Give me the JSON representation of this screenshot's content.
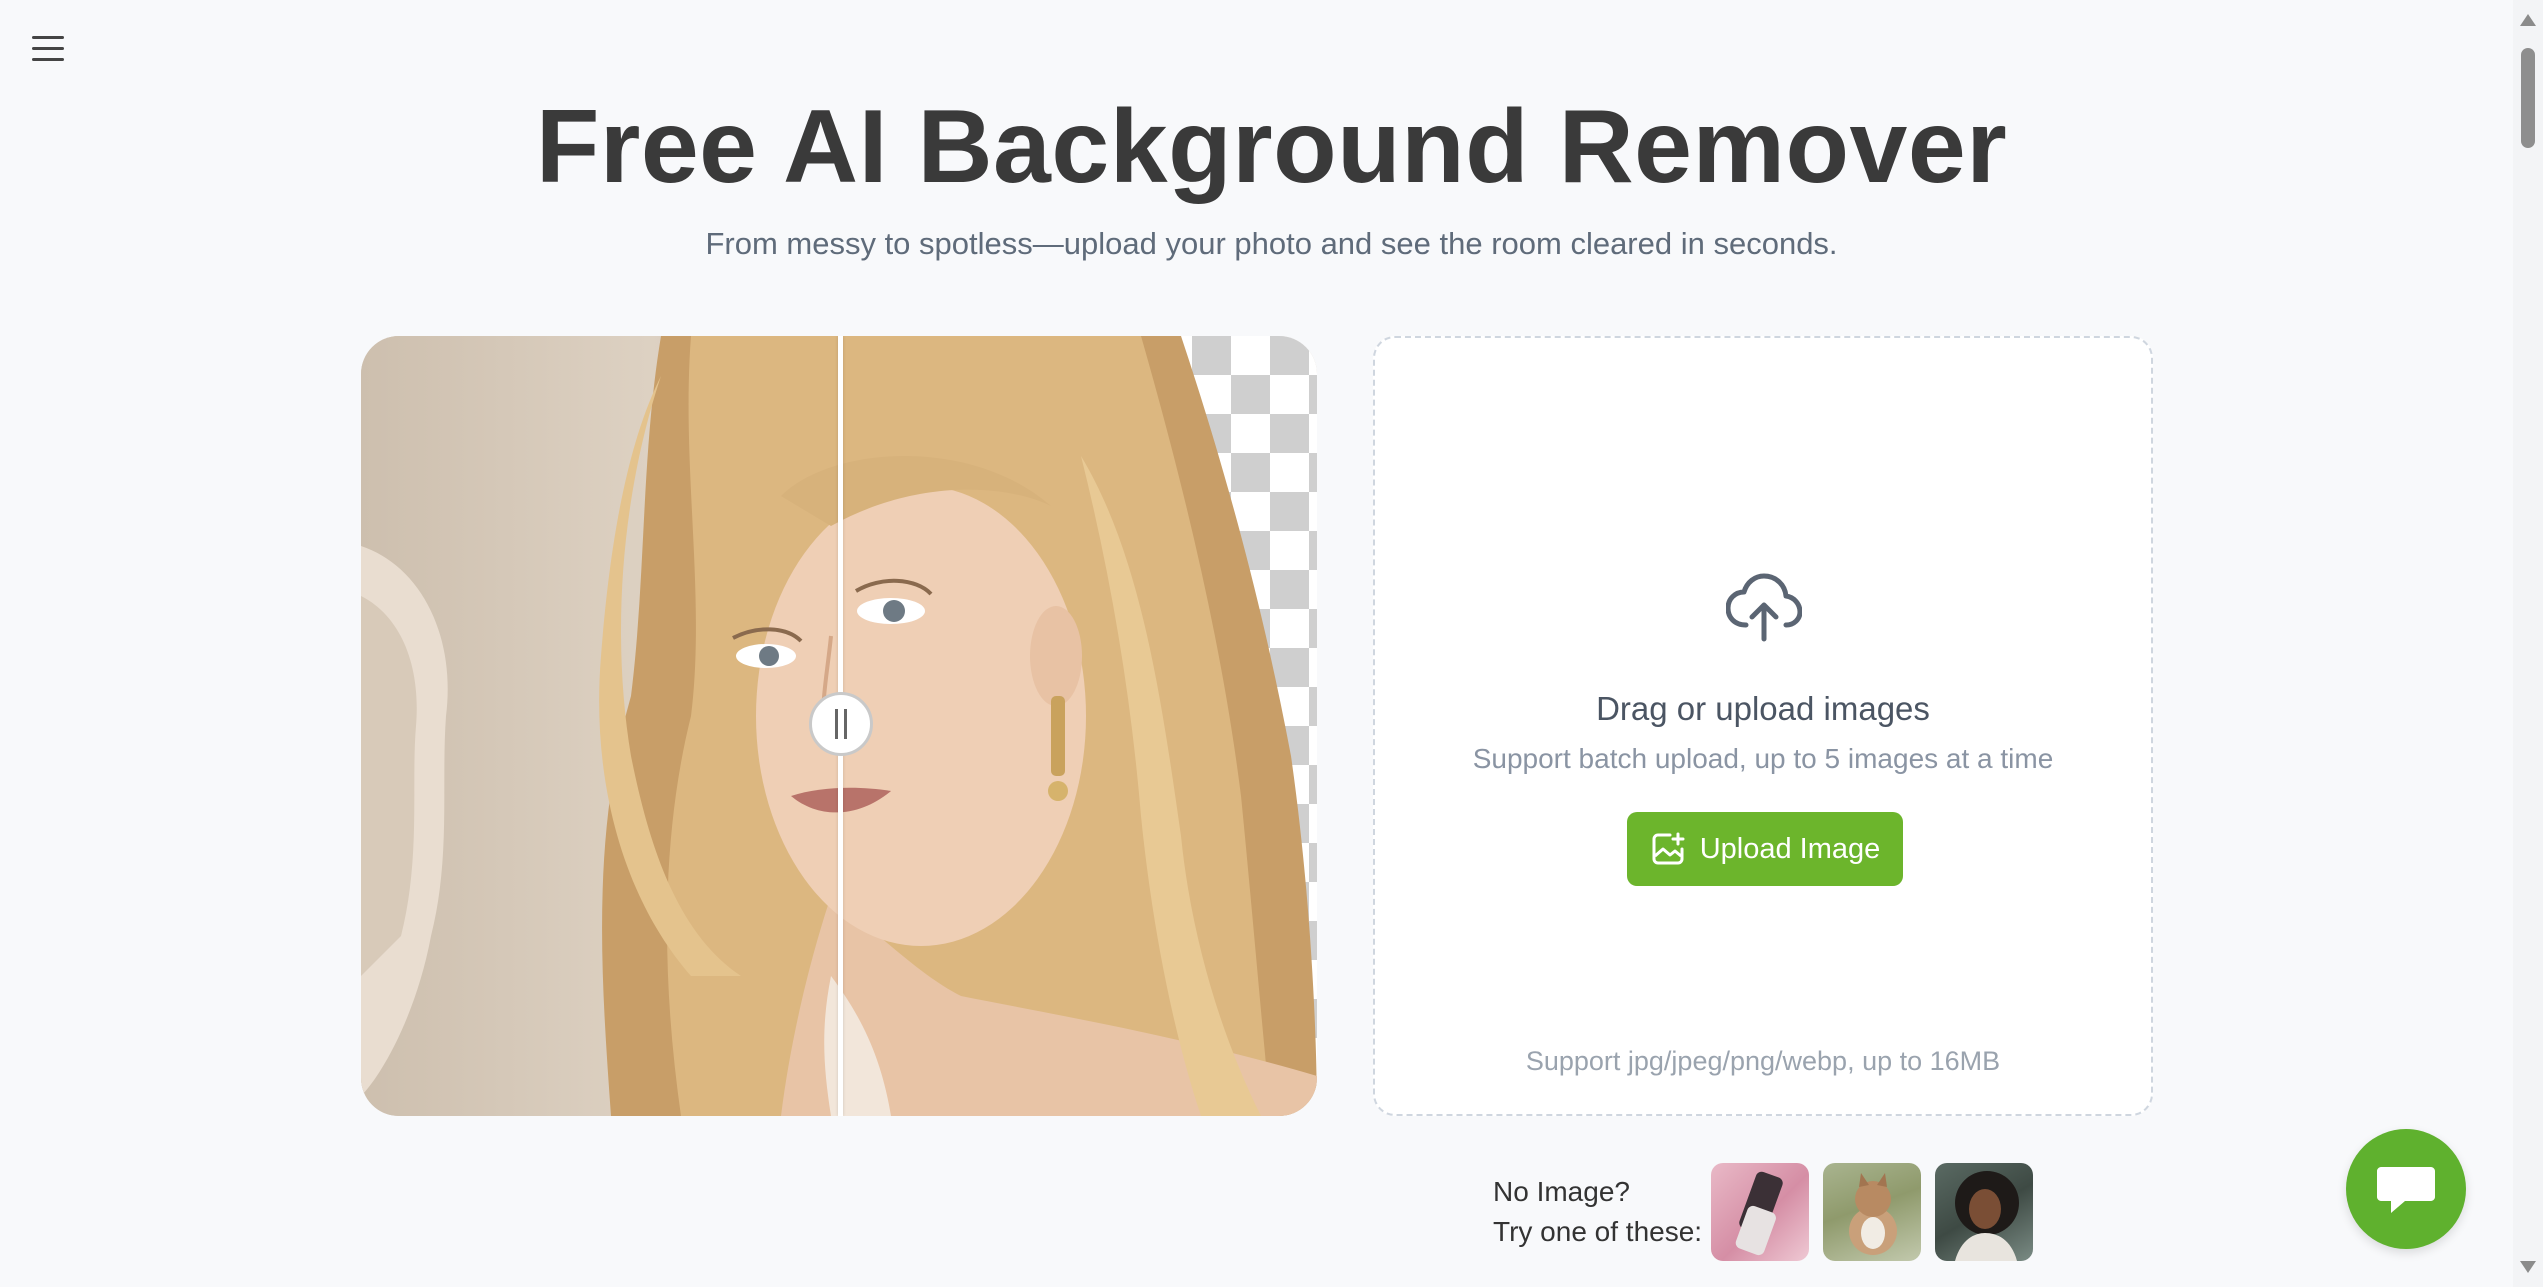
{
  "header": {
    "menu_icon": "hamburger-menu-icon",
    "title": "Free AI Background Remover",
    "subtitle": "From messy to spotless—upload your photo and see the room cleared in seconds."
  },
  "comparison": {
    "divider_position": 0.5
  },
  "upload": {
    "icon": "cloud-upload-icon",
    "title": "Drag or upload images",
    "subtitle": "Support batch upload, up to 5 images at a time",
    "button_label": "Upload Image",
    "button_icon": "add-image-icon",
    "note": "Support jpg/jpeg/png/webp, up to 16MB",
    "accent_color": "#6cb52c"
  },
  "samples": {
    "label_line1": "No Image?",
    "label_line2": "Try one of these:"
  },
  "chat": {
    "icon": "chat-bubble-icon",
    "color": "#5fb12e"
  }
}
